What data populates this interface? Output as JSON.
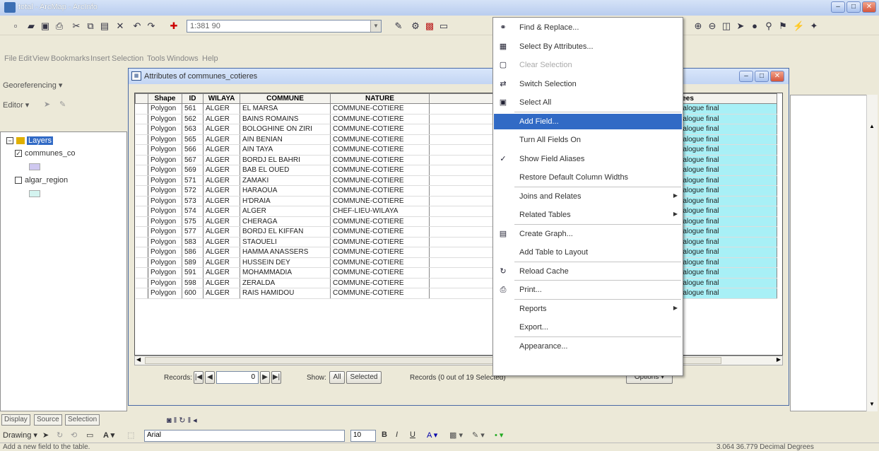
{
  "app": {
    "title": "total - ArcMap - ArcInfo",
    "scale": "1:381 90"
  },
  "menubar": [
    "File",
    "Edit",
    "View",
    "Bookmarks",
    "Insert",
    "Selection",
    "Tools",
    "Windows",
    "Help"
  ],
  "toolbars": {
    "georef_label": "Georeferencing ▾",
    "editor_label": "Editor ▾"
  },
  "toc": {
    "layers_label": "Layers",
    "layer1": "communes_co",
    "layer2": "algar_region",
    "tabs": [
      "Display",
      "Source",
      "Selection"
    ]
  },
  "attr_window": {
    "title": "Attributes of communes_cotieres",
    "columns": [
      "Shape",
      "ID",
      "WILAYA",
      "COMMUNE",
      "NATURE",
      "C",
      "nnees"
    ],
    "rows": [
      [
        "Polygon",
        "561",
        "ALGER",
        "EL MARSA",
        "COMMUNE-COTIERE",
        "",
        "catalogue final"
      ],
      [
        "Polygon",
        "562",
        "ALGER",
        "BAINS ROMAINS",
        "COMMUNE-COTIERE",
        "",
        "catalogue final"
      ],
      [
        "Polygon",
        "563",
        "ALGER",
        "BOLOGHINE ON ZIRI",
        "COMMUNE-COTIERE",
        "",
        "catalogue final"
      ],
      [
        "Polygon",
        "565",
        "ALGER",
        "AIN BENIAN",
        "COMMUNE-COTIERE",
        "",
        "catalogue final"
      ],
      [
        "Polygon",
        "566",
        "ALGER",
        "AIN TAYA",
        "COMMUNE-COTIERE",
        "",
        "catalogue final"
      ],
      [
        "Polygon",
        "567",
        "ALGER",
        "BORDJ EL BAHRI",
        "COMMUNE-COTIERE",
        "",
        "catalogue final"
      ],
      [
        "Polygon",
        "569",
        "ALGER",
        "BAB EL OUED",
        "COMMUNE-COTIERE",
        "",
        "catalogue final"
      ],
      [
        "Polygon",
        "571",
        "ALGER",
        "ZAMAKI",
        "COMMUNE-COTIERE",
        "",
        "catalogue final"
      ],
      [
        "Polygon",
        "572",
        "ALGER",
        "HARAOUA",
        "COMMUNE-COTIERE",
        "",
        "catalogue final"
      ],
      [
        "Polygon",
        "573",
        "ALGER",
        "H'DRAIA",
        "COMMUNE-COTIERE",
        "",
        "catalogue final"
      ],
      [
        "Polygon",
        "574",
        "ALGER",
        "ALGER",
        "CHEF-LIEU-WILAYA",
        "",
        "catalogue final"
      ],
      [
        "Polygon",
        "575",
        "ALGER",
        "CHERAGA",
        "COMMUNE-COTIERE",
        "",
        "catalogue final"
      ],
      [
        "Polygon",
        "577",
        "ALGER",
        "BORDJ EL KIFFAN",
        "COMMUNE-COTIERE",
        "",
        "catalogue final"
      ],
      [
        "Polygon",
        "583",
        "ALGER",
        "STAOUELI",
        "COMMUNE-COTIERE",
        "",
        "catalogue final"
      ],
      [
        "Polygon",
        "586",
        "ALGER",
        "HAMMA ANASSERS",
        "COMMUNE-COTIERE",
        "",
        "catalogue final"
      ],
      [
        "Polygon",
        "589",
        "ALGER",
        "HUSSEIN DEY",
        "COMMUNE-COTIERE",
        "",
        "catalogue final"
      ],
      [
        "Polygon",
        "591",
        "ALGER",
        "MOHAMMADIA",
        "COMMUNE-COTIERE",
        "",
        "catalogue final"
      ],
      [
        "Polygon",
        "598",
        "ALGER",
        "ZERALDA",
        "COMMUNE-COTIERE",
        "",
        "catalogue final"
      ],
      [
        "Polygon",
        "600",
        "ALGER",
        "RAIS HAMIDOU",
        "COMMUNE-COTIERE",
        "",
        "catalogue final"
      ]
    ],
    "records_label": "Records:",
    "record_value": "0",
    "show_label": "Show:",
    "all_label": "All",
    "selected_label": "Selected",
    "records_status": "Records (0 out of 19 Selected)",
    "options_label": "Options ▾"
  },
  "context_menu": {
    "items": [
      {
        "label": "Find & Replace...",
        "icon": "binoculars-icon"
      },
      {
        "label": "Select By Attributes...",
        "icon": "select-attributes-icon"
      },
      {
        "label": "Clear Selection",
        "icon": "clear-selection-icon",
        "disabled": true
      },
      {
        "label": "Switch Selection",
        "icon": "switch-selection-icon"
      },
      {
        "label": "Select All",
        "icon": "select-all-icon"
      },
      {
        "label": "Add Field...",
        "icon": "",
        "active": true
      },
      {
        "label": "Turn All Fields On",
        "icon": ""
      },
      {
        "label": "Show Field Aliases",
        "icon": "checkmark-icon"
      },
      {
        "label": "Restore Default Column Widths",
        "icon": ""
      },
      {
        "label": "Joins and Relates",
        "icon": "",
        "submenu": true
      },
      {
        "label": "Related Tables",
        "icon": "",
        "submenu": true
      },
      {
        "label": "Create Graph...",
        "icon": "graph-icon"
      },
      {
        "label": "Add Table to Layout",
        "icon": ""
      },
      {
        "label": "Reload Cache",
        "icon": "reload-icon"
      },
      {
        "label": "Print...",
        "icon": "printer-icon"
      },
      {
        "label": "Reports",
        "icon": "",
        "submenu": true
      },
      {
        "label": "Export...",
        "icon": ""
      },
      {
        "label": "Appearance...",
        "icon": ""
      }
    ]
  },
  "drawing": {
    "label": "Drawing ▾",
    "font": "Arial",
    "size": "10"
  },
  "status": {
    "message": "Add a new field to the table.",
    "coords": "3.064 36.779 Decimal Degrees"
  },
  "colors": {
    "highlight": "#316ac5",
    "cyan_cells": "#a8f0f6"
  }
}
